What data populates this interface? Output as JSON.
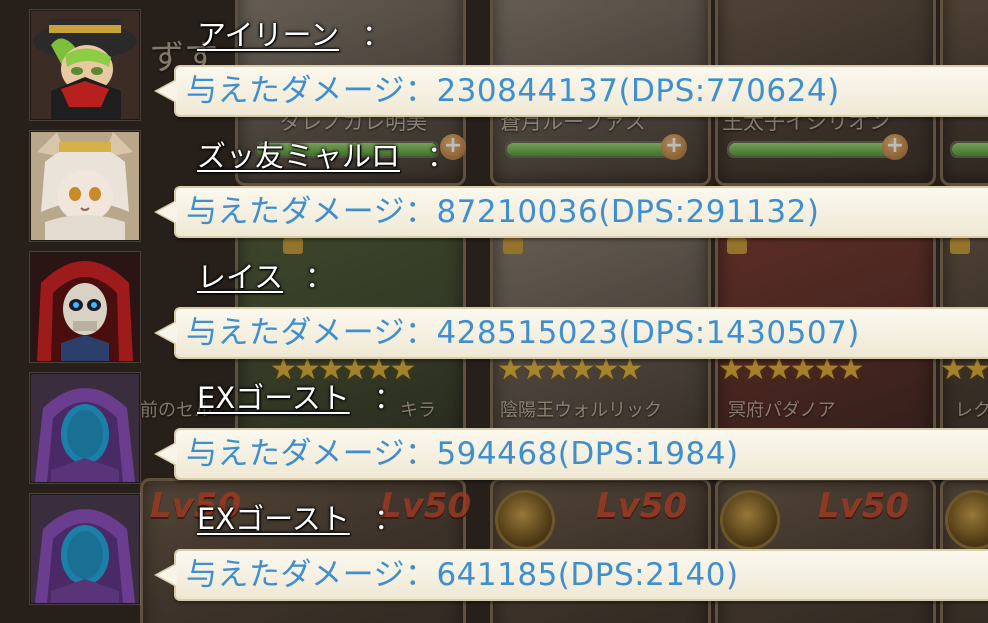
{
  "background": {
    "card_names": [
      "ダレノガレ明美",
      "蒼月ルーファス",
      "王太子イシリオン",
      "陰陽王ウォルリック",
      "冥府パダノア",
      "前のセル",
      "キラ",
      "レク"
    ],
    "level_badges": [
      "Lv50",
      "Lv50",
      "Lv50",
      "Lv50"
    ],
    "partial_header": "ずす"
  },
  "damage_log": [
    {
      "name": "アイリーン",
      "colon": "：",
      "damage_text": "与えたダメージ：230844137(DPS:770624)",
      "avatar_icon": "hero-avatar-irene-icon"
    },
    {
      "name": "ズッ友ミャルロ",
      "colon": "：",
      "damage_text": "与えたダメージ：87210036(DPS:291132)",
      "avatar_icon": "hero-avatar-myarulo-icon"
    },
    {
      "name": "レイス",
      "colon": "：",
      "damage_text": "与えたダメージ：428515023(DPS:1430507)",
      "avatar_icon": "hero-avatar-wraith-icon"
    },
    {
      "name": "EXゴースト",
      "colon": "：",
      "damage_text": "与えたダメージ：594468(DPS:1984)",
      "avatar_icon": "hero-avatar-ghost-icon"
    },
    {
      "name": "EXゴースト",
      "colon": "：",
      "damage_text": "与えたダメージ：641185(DPS:2140)",
      "avatar_icon": "hero-avatar-ghost-icon"
    }
  ],
  "colors": {
    "damage_text": "#3f8fd0",
    "bubble": "#f8f4e8",
    "name_text": "#ffffff"
  }
}
